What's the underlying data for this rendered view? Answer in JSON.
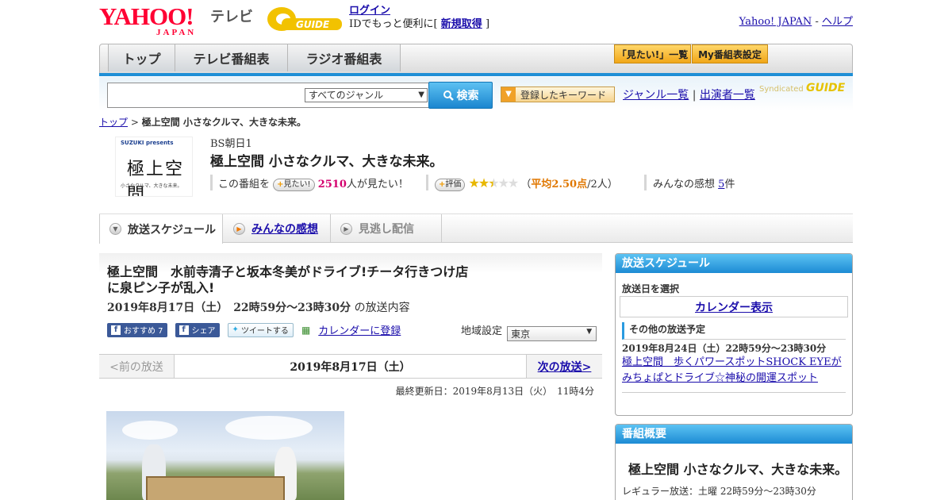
{
  "header": {
    "logo_yahoo": "YAHOO!",
    "logo_japan": "JAPAN",
    "tv_label": "テレビ",
    "gguide_logo": "GUIDE",
    "login": "ログイン",
    "login_hint": "IDでもっと便利に[",
    "signup": "新規取得",
    "login_hint_end": "]",
    "yahoo_japan_link": "Yahoo! JAPAN",
    "separator": "-",
    "help_link": "ヘルプ"
  },
  "nav": {
    "tabs": [
      {
        "label": "トップ"
      },
      {
        "label": "テレビ番組表"
      },
      {
        "label": "ラジオ番組表"
      }
    ],
    "mitai_list": "「見たい!」一覧",
    "my_listing": "My番組表設定"
  },
  "search": {
    "input_value": "",
    "genre_selected": "すべてのジャンル",
    "button_label": "検索",
    "keyword_button": "登録したキーワード",
    "genre_list": "ジャンル一覧",
    "divider": "|",
    "cast_list": "出演者一覧",
    "syndicated": "Syndicated",
    "syndicated_brand": "GUIDE"
  },
  "breadcrumb": {
    "home": "トップ",
    "sep": ">",
    "current": "極上空間 小さなクルマ、大きな未来。"
  },
  "program": {
    "thumb_brand": "SUZUKI presents",
    "thumb_title": "極上空間",
    "thumb_sub": "小さなクルマ、大きな未来。",
    "channel": "BS朝日1",
    "title": "極上空間 小さなクルマ、大きな未来。",
    "mitai_prefix": "この番組を",
    "mitai_button": "見たい!",
    "mitai_count": "2510",
    "mitai_suffix": "人が見たい！",
    "rating_button": "評価",
    "rating_stars": 2.5,
    "rating_open": "（",
    "rating_avg": "平均2.50点",
    "rating_people": "/2人）",
    "review_prefix": "みんなの感想",
    "review_count": "5",
    "review_suffix": "件"
  },
  "content_tabs": {
    "schedule": "放送スケジュール",
    "reviews": "みんなの感想",
    "stream": "見逃し配信"
  },
  "episode": {
    "title": "極上空間　水前寺清子と坂本冬美がドライブ!チータ行きつけ店に泉ピン子が乱入!",
    "date": "2019年8月17日（土）　22時59分～23時30分",
    "date_suffix": "の放送内容",
    "fb_recommend": "おすすめ 7",
    "fb_share": "シェア",
    "tweet": "ツイートする",
    "calendar": "カレンダーに登録",
    "region_label": "地域設定",
    "region_value": "東京",
    "prev": "<前の放送",
    "current": "2019年8月17日（土）",
    "next": "次の放送>",
    "updated": "最終更新日：2019年8月13日（火）　11時4分"
  },
  "sidebar": {
    "schedule_head": "放送スケジュール",
    "pick_date": "放送日を選択",
    "calendar_show": "カレンダー表示",
    "other_head": "その他の放送予定",
    "other_date": "2019年8月24日（土）22時59分～23時30分",
    "other_link": "極上空間　歩くパワースポットSHOCK EYEがみちょぱとドライブ☆神秘の開運スポット",
    "overview_head": "番組概要",
    "overview_title": "極上空間 小さなクルマ、大きな未来。",
    "overview_regular": "レギュラー放送：土曜 22時59分～23時30分"
  },
  "colors": {
    "accent_blue": "#1f8fd6",
    "link": "#1a0dab",
    "yahoo_red": "#ff0033",
    "orange": "#e07700"
  }
}
